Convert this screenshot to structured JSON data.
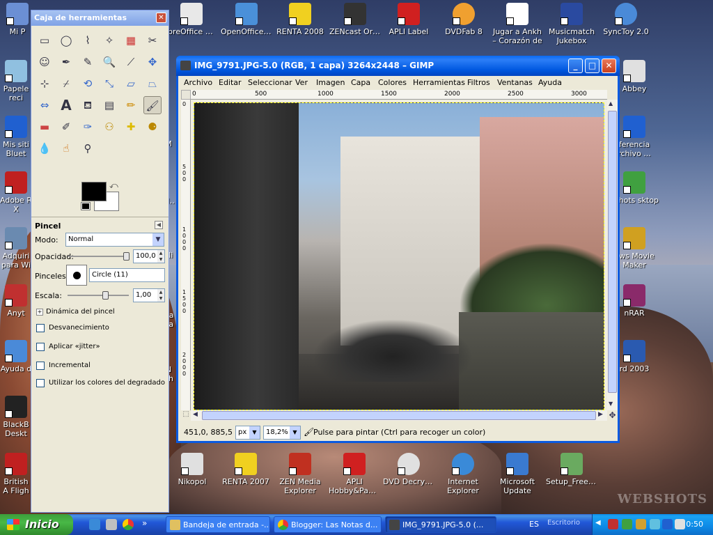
{
  "desktop": {
    "top_icons": [
      {
        "label": "Mi P",
        "color": "#6b8fd4"
      },
      {
        "label": "ibreOffice 3.3",
        "color": "#e8e8e8"
      },
      {
        "label": "OpenOffice... 3.3",
        "color": "#4a90d9"
      },
      {
        "label": "RENTA 2008",
        "color": "#f0d020"
      },
      {
        "label": "ZENcast Organizer",
        "color": "#333333"
      },
      {
        "label": "APLI Label",
        "color": "#d02020"
      },
      {
        "label": "DVDFab 8",
        "color": "#f0a030"
      },
      {
        "label": "Jugar a Ankh – Corazón de ...",
        "color": "#ffffff"
      },
      {
        "label": "Musicmatch Jukebox",
        "color": "#2a4aa0"
      },
      {
        "label": "SyncToy 2.0",
        "color": "#4a8ad8"
      }
    ],
    "left_icons": [
      {
        "label": "Papele reci",
        "color": "#90c0e0"
      },
      {
        "label": "Mis siti Bluet",
        "color": "#2060d0"
      },
      {
        "label": "Adobe R X",
        "color": "#c02020"
      },
      {
        "label": "Adquiri para Wi",
        "color": "#6a8ab0"
      },
      {
        "label": "Anyt",
        "color": "#c03030"
      },
      {
        "label": "Ayuda d",
        "color": "#4a8ad8"
      },
      {
        "label": "BlackB Deskt",
        "color": "#222222"
      },
      {
        "label": "British A Fligh",
        "color": "#c02020"
      }
    ],
    "right_icons": [
      {
        "label": "Abbey",
        "color": "#e0e0e0"
      },
      {
        "label": "ferencia rchivo ...",
        "color": "#2060d0"
      },
      {
        "label": "bshots sktop",
        "color": "#40a040"
      },
      {
        "label": "ows Movie Maker",
        "color": "#d0a020"
      },
      {
        "label": "nRAR",
        "color": "#8a2a6a"
      },
      {
        "label": "rd 2003",
        "color": "#2a5ab0"
      }
    ],
    "partial_labels": [
      "Mo",
      "Mi",
      "Na Ra",
      "N Sh",
      "M"
    ],
    "bottom_icons": [
      {
        "label": "Nikopol",
        "color": "#e0e0e0"
      },
      {
        "label": "RENTA 2007",
        "color": "#f0d020"
      },
      {
        "label": "ZEN Media Explorer",
        "color": "#c03020"
      },
      {
        "label": "APLI Hobby&Papers",
        "color": "#d02020"
      },
      {
        "label": "DVD Decrypter",
        "color": "#e0e0e0"
      },
      {
        "label": "Internet Explorer",
        "color": "#3a8ad8"
      },
      {
        "label": "Microsoft Update",
        "color": "#3a7ad0"
      },
      {
        "label": "Setup_Free....",
        "color": "#6aaa60"
      }
    ],
    "watermark": "WEBSHOTS"
  },
  "toolbox": {
    "title": "Caja de herramientas",
    "close_icon": "close-icon",
    "tools": [
      "rect-select",
      "ellipse-select",
      "free-select",
      "fuzzy-select",
      "color-select",
      "scissors",
      "foreground-select",
      "paths",
      "color-picker",
      "zoom",
      "measure",
      "move",
      "align",
      "crop",
      "rotate",
      "scale",
      "shear",
      "perspective",
      "flip",
      "text",
      "bucket-fill",
      "blend",
      "pencil",
      "paintbrush",
      "eraser",
      "airbrush",
      "ink",
      "clone",
      "heal",
      "perspective-clone",
      "blur",
      "smudge",
      "dodge-burn"
    ],
    "active_tool": "paintbrush",
    "fg_color": "#000000",
    "bg_color": "#ffffff",
    "options_title": "Pincel",
    "mode_label": "Modo:",
    "mode_value": "Normal",
    "opacity_label": "Opacidad:",
    "opacity_value": "100,0",
    "brushes_label": "Pinceles:",
    "brush_name": "Circle (11)",
    "scale_label": "Escala:",
    "scale_value": "1,00",
    "dynamics_label": "Dinámica del pincel",
    "checkboxes": [
      "Desvanecimiento",
      "Aplicar «jitter»",
      "Incremental",
      "Utilizar los colores del degradado"
    ]
  },
  "gimp": {
    "title": "IMG_9791.JPG-5.0 (RGB, 1 capa) 3264x2448 – GIMP",
    "menu": [
      "Archivo",
      "Editar",
      "Seleccionar",
      "Ver",
      "Imagen",
      "Capa",
      "Colores",
      "Herramientas",
      "Filtros",
      "Ventanas",
      "Ayuda"
    ],
    "ruler_h": [
      "0",
      "500",
      "1000",
      "1500",
      "2000",
      "2500",
      "3000"
    ],
    "ruler_v": [
      "0",
      "500",
      "1000",
      "1500",
      "2000"
    ],
    "coords": "451,0, 885,5",
    "unit": "px",
    "zoom": "18,2%",
    "status_msg": "Pulse para pintar (Ctrl para recoger un color)"
  },
  "taskbar": {
    "start_label": "Inicio",
    "tasks": [
      "Bandeja de entrada -...",
      "Blogger: Las Notas d...",
      "IMG_9791.JPG-5.0 (..."
    ],
    "active_task": 2,
    "language": "ES",
    "deskbar": "Escritorio",
    "clock": "0:50"
  }
}
